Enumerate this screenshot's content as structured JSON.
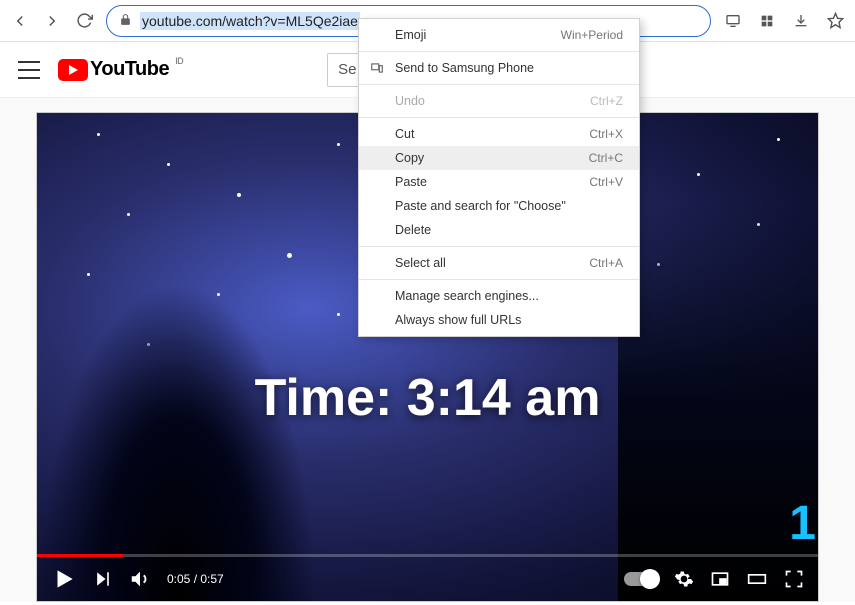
{
  "browser": {
    "url": "youtube.com/watch?v=ML5Qe2iae"
  },
  "youtube": {
    "brand": "YouTube",
    "region": "ID",
    "search_placeholder": "Se"
  },
  "video": {
    "overlay_text": "Time: 3:14 am",
    "corner": "1",
    "elapsed": "0:05",
    "duration": "0:57",
    "progress_percent": 11
  },
  "ctx": {
    "emoji": "Emoji",
    "emoji_sc": "Win+Period",
    "send": "Send to Samsung Phone",
    "undo": "Undo",
    "undo_sc": "Ctrl+Z",
    "cut": "Cut",
    "cut_sc": "Ctrl+X",
    "copy": "Copy",
    "copy_sc": "Ctrl+C",
    "paste": "Paste",
    "paste_sc": "Ctrl+V",
    "paste_search": "Paste and search for \"Choose\"",
    "delete": "Delete",
    "select_all": "Select all",
    "select_all_sc": "Ctrl+A",
    "manage": "Manage search engines...",
    "show_urls": "Always show full URLs"
  }
}
